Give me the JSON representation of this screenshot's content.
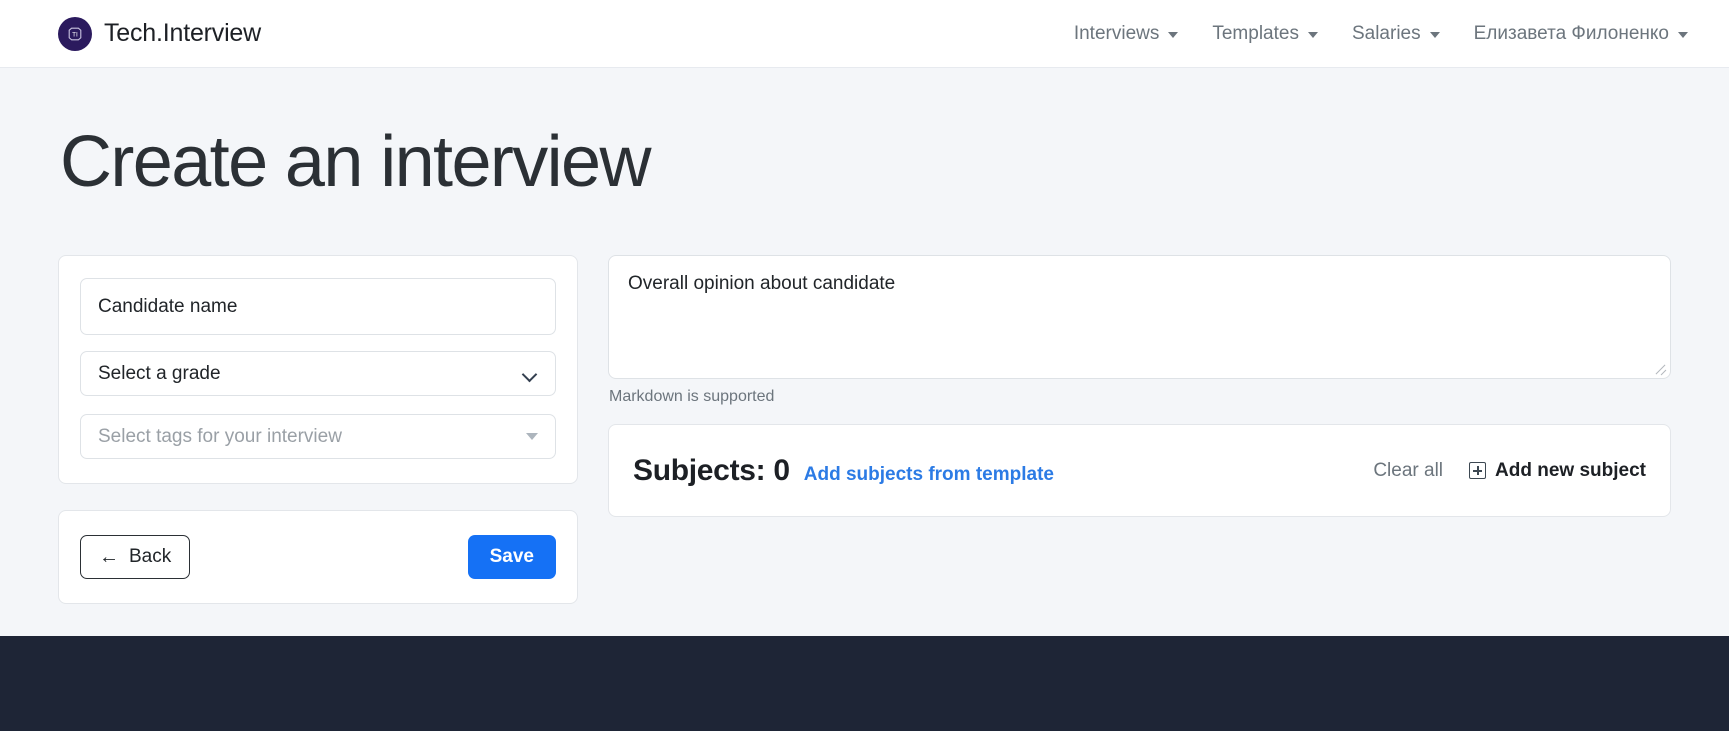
{
  "navbar": {
    "brand": {
      "name": "Tech.Interview",
      "logo_text": "TI",
      "logo_bg": "#2b1a5e"
    },
    "menu": [
      {
        "label": "Interviews",
        "has_caret": true
      },
      {
        "label": "Templates",
        "has_caret": true
      },
      {
        "label": "Salaries",
        "has_caret": true
      },
      {
        "label": "Елизавета Филоненко",
        "has_caret": true
      }
    ]
  },
  "main": {
    "page_title": "Create an interview",
    "form": {
      "candidate_name": {
        "value": "Candidate name",
        "placeholder": "Candidate name"
      },
      "grade_select": {
        "value": "Select a grade",
        "icon": "chevron-down-icon"
      },
      "tags_select": {
        "placeholder": "Select tags for your interview",
        "icon": "triangle-down-icon"
      }
    },
    "actions": {
      "back_label": "Back",
      "back_icon": "arrow-left-icon",
      "save_label": "Save",
      "save_color": "#1571f5"
    },
    "opinion": {
      "placeholder": "Overall opinion about candidate",
      "value": "",
      "helper": "Markdown is supported"
    },
    "subjects": {
      "title_prefix": "Subjects:",
      "count": "0",
      "title": "Subjects: 0",
      "add_from_template_label": "Add subjects from template",
      "add_from_template_color": "#2c7be5",
      "clear_all_label": "Clear all",
      "add_new_label": "Add new subject",
      "add_new_icon": "plus-square-icon"
    }
  },
  "footer": {
    "background": "#1e2536"
  }
}
